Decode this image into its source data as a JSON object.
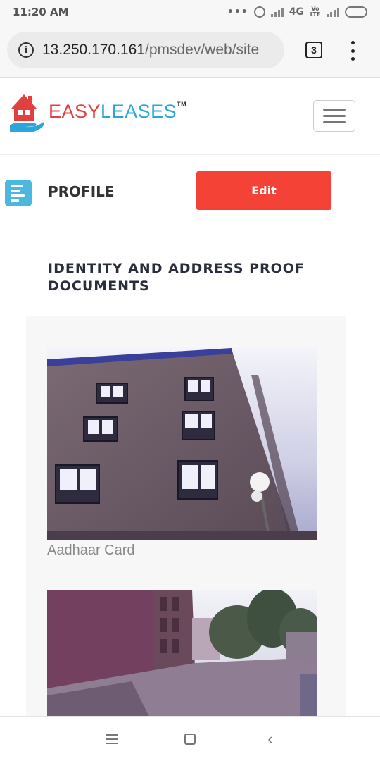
{
  "status_bar": {
    "time": "11:20 AM",
    "network": "4G",
    "volte": "Vo LTE"
  },
  "browser": {
    "url_host": "13.250.170.161",
    "url_path": "/pmsdev/web/site",
    "tab_count": "3"
  },
  "site": {
    "logo_easy": "EASY",
    "logo_leases": "LEASES",
    "logo_tm": "TM"
  },
  "profile": {
    "title": "PROFILE",
    "edit_label": "Edit"
  },
  "documents": {
    "section_title": "IDENTITY AND ADDRESS PROOF DOCUMENTS",
    "items": [
      {
        "label": "Aadhaar Card"
      },
      {
        "label": ""
      }
    ]
  },
  "colors": {
    "accent_red": "#f44336",
    "brand_blue": "#2aa6d9",
    "brand_red": "#e04040"
  }
}
